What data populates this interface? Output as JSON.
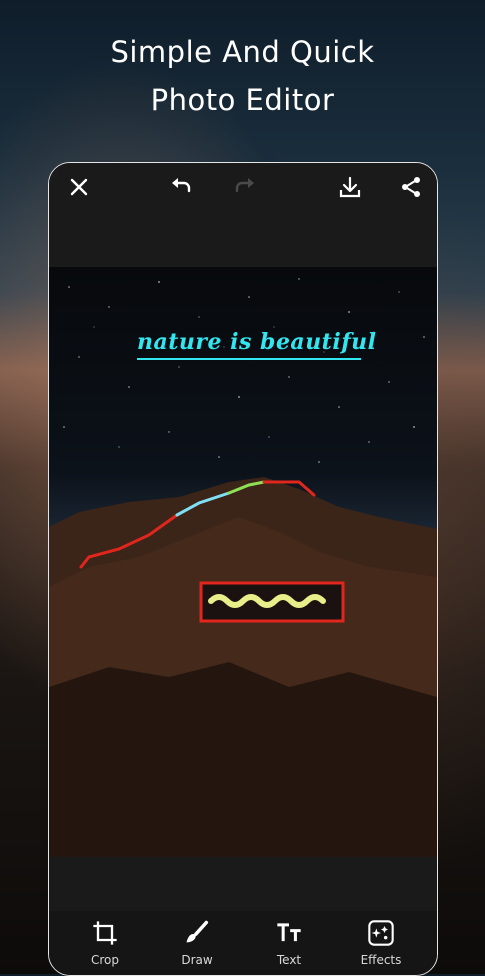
{
  "headline": {
    "line1": "Simple And Quick",
    "line2": "Photo Editor"
  },
  "toolbar": {
    "close_icon": "close-icon",
    "undo_icon": "undo-icon",
    "redo_icon": "redo-icon",
    "download_icon": "download-icon",
    "share_icon": "share-icon"
  },
  "canvas": {
    "overlay_text": "nature is beautiful"
  },
  "tools": [
    {
      "label": "Crop",
      "icon": "crop-icon"
    },
    {
      "label": "Draw",
      "icon": "brush-icon"
    },
    {
      "label": "Text",
      "icon": "text-icon"
    },
    {
      "label": "Effects",
      "icon": "effects-icon"
    }
  ],
  "colors": {
    "accent_text": "#32e6f0",
    "stroke_red": "#e0261d",
    "stroke_yellow": "#e8ef8a",
    "stroke_green": "#8fe055",
    "stroke_cyan": "#7fe0f5"
  }
}
